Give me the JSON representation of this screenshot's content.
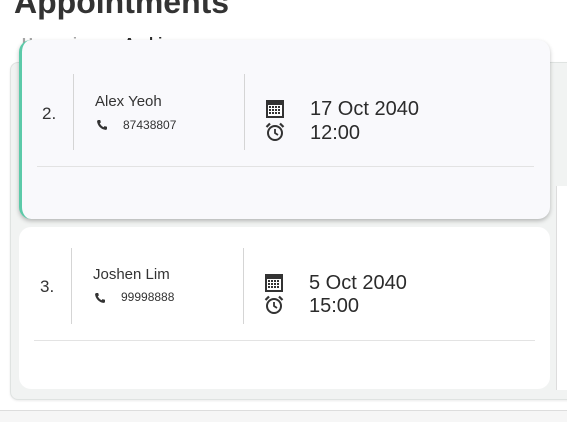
{
  "page": {
    "title": "Appointments"
  },
  "tabs": [
    {
      "label": "Upcoming",
      "active": false
    },
    {
      "label": "Archive",
      "active": true
    }
  ],
  "appointments": [
    {
      "index": "2.",
      "name": "Alex Yeoh",
      "phone": "87438807",
      "date": "17 Oct 2040",
      "time": "12:00",
      "selected": true
    },
    {
      "index": "3.",
      "name": "Joshen Lim",
      "phone": "99998888",
      "date": "5 Oct 2040",
      "time": "15:00",
      "selected": false
    }
  ],
  "colors": {
    "accent": "#5fc9a8",
    "selected_card_bg": "#f9f9fc",
    "card_bg": "#ffffff",
    "pane_bg": "#f1f3f2"
  },
  "icons": {
    "phone": "phone-icon",
    "calendar": "calendar-icon",
    "clock": "alarm-clock-icon"
  }
}
